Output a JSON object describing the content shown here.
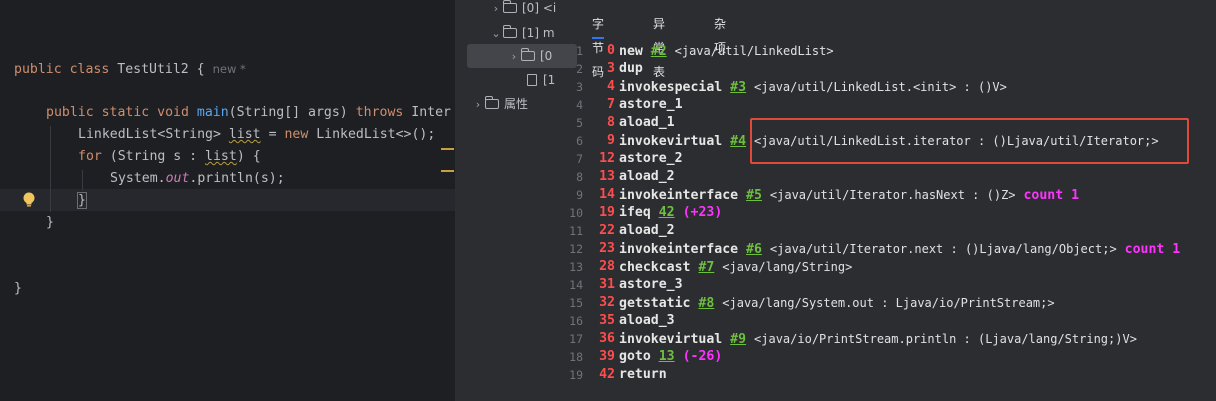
{
  "editor": {
    "class_decl": {
      "mod": "public",
      "kw": "class",
      "name": "TestUtil2",
      "brace": "{",
      "hint": "new *"
    },
    "main_decl": {
      "mods": "public static void",
      "name": "main",
      "params": "(String[] args)",
      "throws_kw": "throws",
      "throws_rest": "Inter"
    },
    "line_list": {
      "a": "LinkedList<String> ",
      "var": "list",
      "b": " = ",
      "kw": "new",
      "c": " LinkedList<>();"
    },
    "line_for": {
      "kw": "for",
      "a": " (String s : ",
      "var": "list",
      "b": ") {"
    },
    "line_print": {
      "a": "System.",
      "field": "out",
      "b": ".println(s);"
    },
    "close_inner": "}",
    "close_method": "}",
    "close_class": "}"
  },
  "tree": {
    "items": [
      {
        "label": "[0] <i"
      },
      {
        "label": "[1] m"
      },
      {
        "label": "[0"
      },
      {
        "label": "[1"
      },
      {
        "label": "属性"
      }
    ]
  },
  "tabs": [
    {
      "label": "字节码"
    },
    {
      "label": "异常表"
    },
    {
      "label": "杂项"
    }
  ],
  "bytecode": [
    {
      "ln": "1",
      "off": "0",
      "op": "new",
      "ref": "#2",
      "desc": "<java/util/LinkedList>"
    },
    {
      "ln": "2",
      "off": "3",
      "op": "dup"
    },
    {
      "ln": "3",
      "off": "4",
      "op": "invokespecial",
      "ref": "#3",
      "desc": "<java/util/LinkedList.<init> : ()V>"
    },
    {
      "ln": "4",
      "off": "7",
      "op": "astore_1"
    },
    {
      "ln": "5",
      "off": "8",
      "op": "aload_1"
    },
    {
      "ln": "6",
      "off": "9",
      "op": "invokevirtual",
      "ref": "#4",
      "desc": "<java/util/LinkedList.iterator : ()Ljava/util/Iterator;>"
    },
    {
      "ln": "7",
      "off": "12",
      "op": "astore_2"
    },
    {
      "ln": "8",
      "off": "13",
      "op": "aload_2"
    },
    {
      "ln": "9",
      "off": "14",
      "op": "invokeinterface",
      "ref": "#5",
      "desc": "<java/util/Iterator.hasNext : ()Z>",
      "count": "count 1"
    },
    {
      "ln": "10",
      "off": "19",
      "op": "ifeq",
      "ref": "42",
      "jump": "(+23)"
    },
    {
      "ln": "11",
      "off": "22",
      "op": "aload_2"
    },
    {
      "ln": "12",
      "off": "23",
      "op": "invokeinterface",
      "ref": "#6",
      "desc": "<java/util/Iterator.next : ()Ljava/lang/Object;>",
      "count": "count 1"
    },
    {
      "ln": "13",
      "off": "28",
      "op": "checkcast",
      "ref": "#7",
      "desc": "<java/lang/String>"
    },
    {
      "ln": "14",
      "off": "31",
      "op": "astore_3"
    },
    {
      "ln": "15",
      "off": "32",
      "op": "getstatic",
      "ref": "#8",
      "desc": "<java/lang/System.out : Ljava/io/PrintStream;>"
    },
    {
      "ln": "16",
      "off": "35",
      "op": "aload_3"
    },
    {
      "ln": "17",
      "off": "36",
      "op": "invokevirtual",
      "ref": "#9",
      "desc": "<java/io/PrintStream.println : (Ljava/lang/String;)V>"
    },
    {
      "ln": "18",
      "off": "39",
      "op": "goto",
      "ref": "13",
      "jump": "(-26)"
    },
    {
      "ln": "19",
      "off": "42",
      "op": "return"
    }
  ],
  "colors": {
    "highlight_box": "#e04a3a",
    "offset": "#ff4d4d",
    "ref": "#6fbf3f",
    "count": "#ff33ff",
    "tab_underline": "#3574f0"
  }
}
